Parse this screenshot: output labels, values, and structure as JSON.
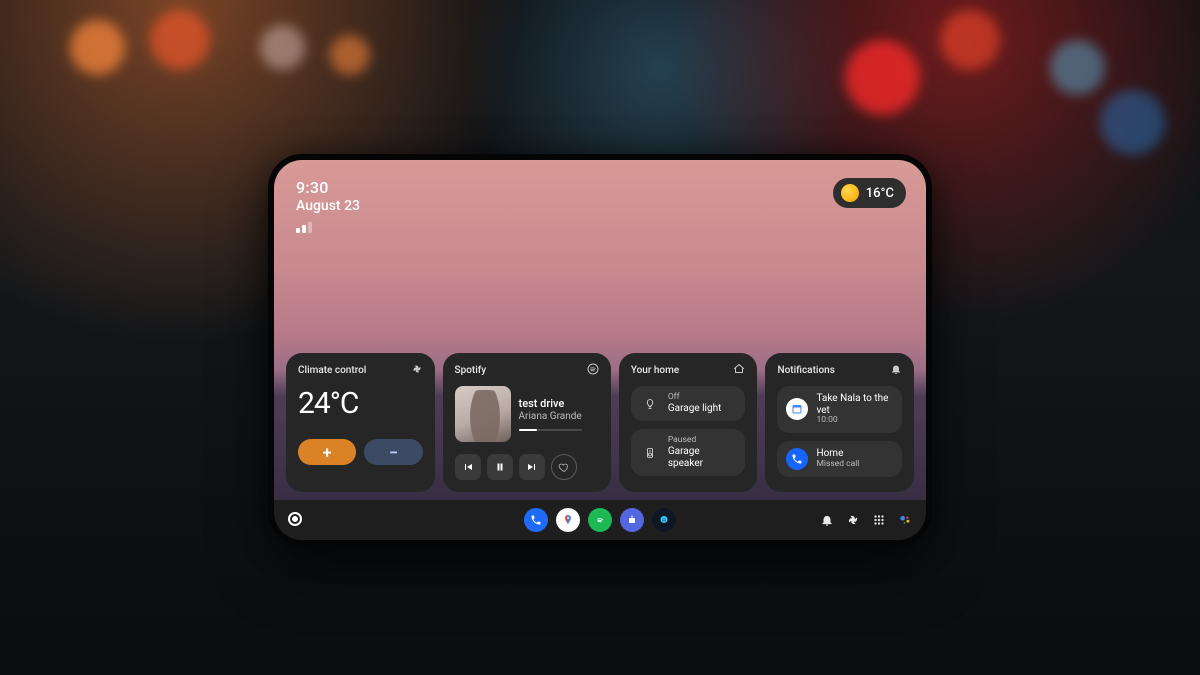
{
  "status": {
    "time": "9:30",
    "date": "August 23"
  },
  "weather": {
    "temp": "16°C"
  },
  "climate": {
    "title": "Climate control",
    "temperature": "24°C",
    "plus": "+",
    "minus": "−"
  },
  "spotify": {
    "title": "Spotify",
    "track": "test drive",
    "artist": "Ariana Grande"
  },
  "home": {
    "title": "Your home",
    "items": [
      {
        "state": "Off",
        "name": "Garage light"
      },
      {
        "state": "Paused",
        "name": "Garage speaker"
      }
    ]
  },
  "notifications": {
    "title": "Notifications",
    "items": [
      {
        "title": "Take Nala to the vet",
        "sub": "10:00"
      },
      {
        "title": "Home",
        "sub": "Missed call"
      }
    ]
  }
}
